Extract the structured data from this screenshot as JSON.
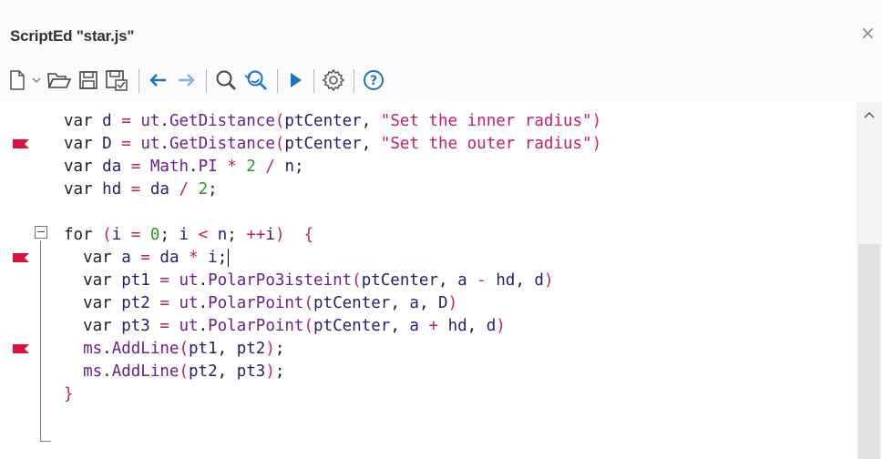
{
  "window": {
    "title": "ScriptEd \"star.js\"",
    "close_label": "×"
  },
  "toolbar": {
    "buttons": [
      {
        "name": "new-file",
        "icon": "new-file-icon"
      },
      {
        "name": "new-dropdown",
        "icon": "chevron-down-icon"
      },
      {
        "name": "open",
        "icon": "folder-open-icon"
      },
      {
        "name": "save",
        "icon": "floppy-disk-icon"
      },
      {
        "name": "save-as",
        "icon": "floppy-disk-check-icon"
      },
      {
        "name": "back",
        "icon": "arrow-left-icon"
      },
      {
        "name": "forward",
        "icon": "arrow-right-icon"
      },
      {
        "name": "find",
        "icon": "magnifier-icon"
      },
      {
        "name": "replace",
        "icon": "find-replace-icon"
      },
      {
        "name": "run",
        "icon": "play-icon"
      },
      {
        "name": "settings",
        "icon": "gear-icon"
      },
      {
        "name": "help",
        "icon": "help-icon"
      }
    ],
    "colors": {
      "icon_blue": "#1a73c7",
      "icon_gray": "#555555"
    }
  },
  "editor": {
    "lines": [
      "var d = ut.GetDistance(ptCenter, \"Set the inner radius\")",
      "var D = ut.GetDistance(ptCenter, \"Set the outer radius\")",
      "var da = Math.PI * 2 / n;",
      "var hd = da / 2;",
      "",
      "for (i = 0; i < n; ++i)  {",
      "  var a = da * i;",
      "  var pt1 = ut.PolarPo3isteint(ptCenter, a - hd, d)",
      "  var pt2 = ut.PolarPoint(ptCenter, a, D)",
      "  var pt3 = ut.PolarPoint(ptCenter, a + hd, d)",
      "  ms.AddLine(pt1, pt2);",
      "  ms.AddLine(pt2, pt3);",
      "}"
    ],
    "bookmark_lines": [
      2,
      7,
      11
    ],
    "colors": {
      "string": "#c51b6b",
      "number": "#1f9d1f",
      "bookmark": "#d8143c",
      "identifier": "#6b1f8a"
    }
  }
}
